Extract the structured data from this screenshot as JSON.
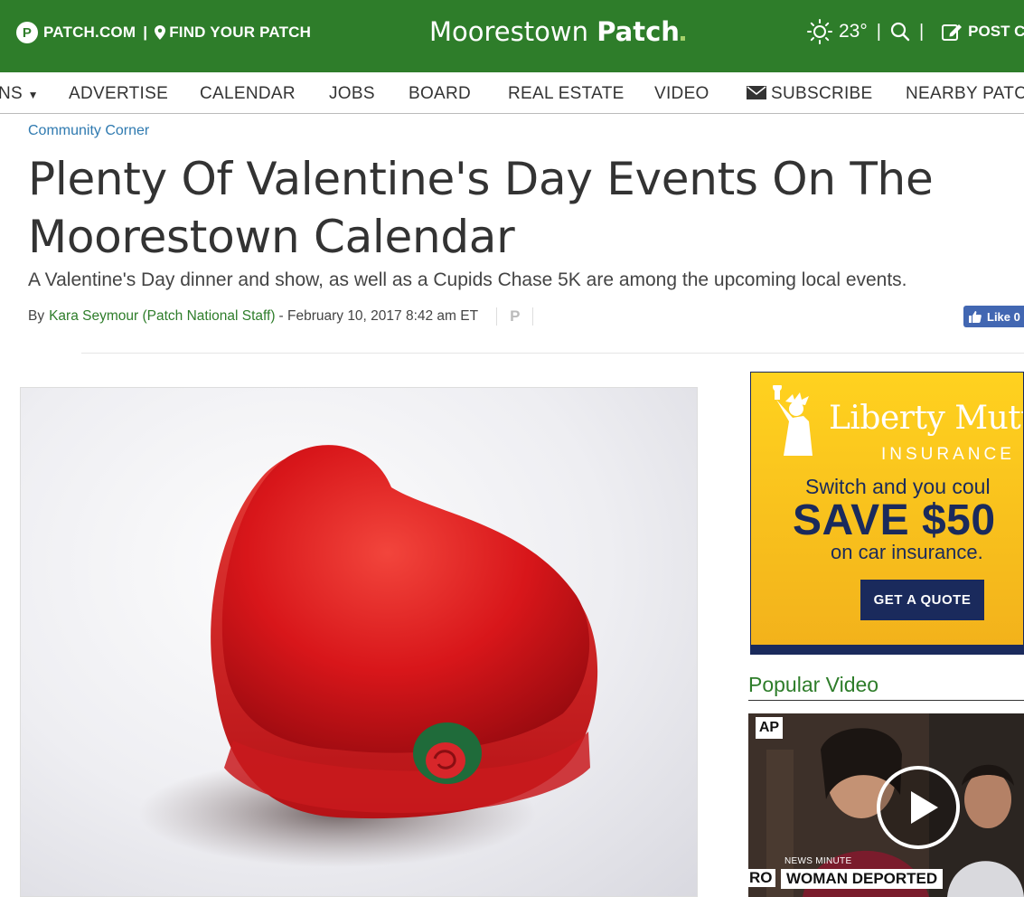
{
  "header": {
    "patch_com": "PATCH.COM",
    "separator": "|",
    "find_patch": "FIND YOUR PATCH",
    "brand_light": "Moorestown",
    "brand_bold": "Patch",
    "temperature": "23°",
    "post_label": "POST C"
  },
  "nav": {
    "items": [
      "NS",
      "ADVERTISE",
      "CALENDAR",
      "JOBS",
      "BOARD",
      "REAL ESTATE",
      "VIDEO",
      "SUBSCRIBE",
      "NEARBY PATC"
    ]
  },
  "article": {
    "category": "Community Corner",
    "headline": "Plenty Of Valentine's Day Events On The Moorestown Calendar",
    "subhead": "A Valentine's Day dinner and show, as well as a Cupids Chase 5K are among the upcoming local events.",
    "by_label": "By",
    "author": "Kara Seymour (Patch National Staff)",
    "date": "- February 10, 2017 8:42 am ET",
    "patch_mark": "P",
    "like_label": "Like 0"
  },
  "ad": {
    "brand": "Liberty Mutu",
    "insurance": "INSURANCE",
    "line1": "Switch and you coul",
    "save": "SAVE $50",
    "line3": "on car insurance.",
    "cta": "GET A QUOTE",
    "colors": {
      "background": "#f6bd1b",
      "navy": "#1a2a5c"
    }
  },
  "popular_video": {
    "title": "Popular Video",
    "source_badge": "AP",
    "kicker": "NEWS MINUTE",
    "caption": "WOMAN DEPORTED",
    "caption_left": "RO"
  },
  "colors": {
    "brand_green": "#2e7d2a",
    "link_blue": "#2f7ab0",
    "facebook_blue": "#4267b2"
  }
}
